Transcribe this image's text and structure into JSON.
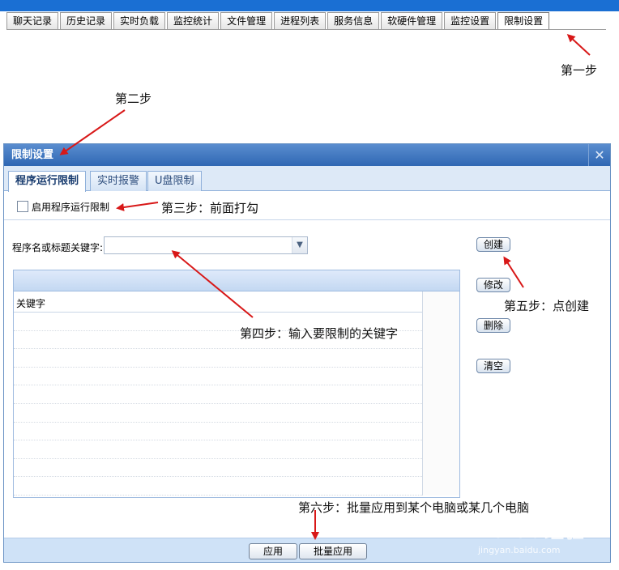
{
  "main_tabs": [
    {
      "label": "聊天记录"
    },
    {
      "label": "历史记录"
    },
    {
      "label": "实时负载"
    },
    {
      "label": "监控统计"
    },
    {
      "label": "文件管理"
    },
    {
      "label": "进程列表"
    },
    {
      "label": "服务信息"
    },
    {
      "label": "软硬件管理"
    },
    {
      "label": "监控设置"
    },
    {
      "label": "限制设置",
      "active": true
    }
  ],
  "annotations": {
    "step1": "第一步",
    "step2": "第二步",
    "step3": "第三步：前面打勾",
    "step4": "第四步：输入要限制的关键字",
    "step5": "第五步：点创建",
    "step6": "第六步：批量应用到某个电脑或某几个电脑"
  },
  "dialog": {
    "title": "限制设置",
    "close_icon": "close-icon",
    "tabs": [
      {
        "label": "程序运行限制",
        "active": true
      },
      {
        "label": "实时报警"
      },
      {
        "label": "U盘限制"
      }
    ],
    "enable_checkbox": {
      "label": "启用程序运行限制",
      "checked": false
    },
    "keyword_label": "程序名或标题关键字:",
    "keyword_value": "",
    "grid": {
      "columns": [
        "关键字"
      ],
      "rows": 10
    },
    "side_buttons": {
      "create": "创建",
      "modify": "修改",
      "delete": "删除",
      "clear": "清空"
    },
    "footer": {
      "apply": "应用",
      "batch_apply": "批量应用"
    }
  },
  "watermark": {
    "main": "Baidu经验",
    "sub": "jingyan.baidu.com"
  }
}
